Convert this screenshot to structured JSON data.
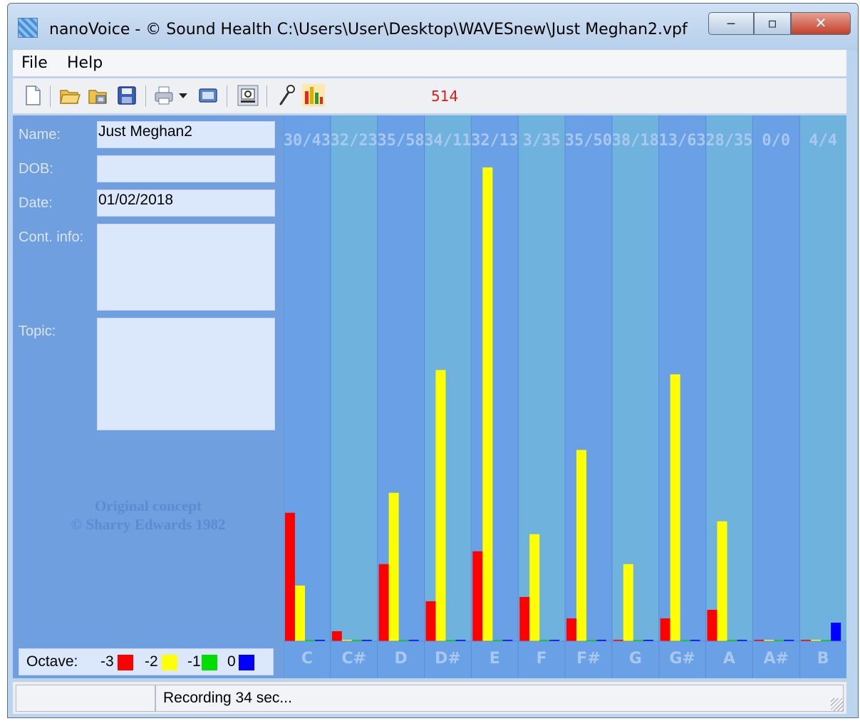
{
  "window": {
    "title": "nanoVoice - © Sound Health C:\\Users\\User\\Desktop\\WAVESnew\\Just Meghan2.vpf"
  },
  "menu": {
    "file": "File",
    "help": "Help"
  },
  "toolbar": {
    "icons": [
      "new-icon",
      "open-icon",
      "open-archive-icon",
      "save-icon",
      "print-icon",
      "dropdown-icon",
      "screen-icon",
      "chart-mode-icon",
      "microphone-icon",
      "bar-chart-icon"
    ],
    "counter": "514"
  },
  "form": {
    "name_label": "Name:",
    "name_value": "Just Meghan2",
    "dob_label": "DOB:",
    "dob_value": "",
    "date_label": "Date:",
    "date_value": "01/02/2018",
    "contact_label": "Cont. info:",
    "contact_value": "",
    "topic_label": "Topic:",
    "topic_value": "",
    "concept_line1": "Original concept",
    "concept_line2": "© Sharry Edwards 1982"
  },
  "octave_legend": {
    "label": "Octave:",
    "items": [
      {
        "label": "-3",
        "color": "#ff0000"
      },
      {
        "label": "-2",
        "color": "#ffff00"
      },
      {
        "label": "-1",
        "color": "#00dd00"
      },
      {
        "label": "0",
        "color": "#0000ff"
      }
    ]
  },
  "chart_data": {
    "type": "bar",
    "categories": [
      "C",
      "C#",
      "D",
      "D#",
      "E",
      "F",
      "F#",
      "G",
      "G#",
      "A",
      "A#",
      "B"
    ],
    "top_labels": [
      "30/43",
      "32/23",
      "35/58",
      "34/11",
      "32/13",
      "3/35",
      "35/50",
      "38/18",
      "13/63",
      "28/35",
      "0/0",
      "4/4"
    ],
    "ylim": [
      0,
      665
    ],
    "series": [
      {
        "name": "-3",
        "color": "#ff0000",
        "values": [
          180,
          14,
          108,
          56,
          126,
          62,
          32,
          0,
          32,
          44,
          0,
          0
        ]
      },
      {
        "name": "-2",
        "color": "#ffff00",
        "values": [
          78,
          0,
          208,
          380,
          664,
          150,
          268,
          108,
          374,
          168,
          0,
          0
        ]
      },
      {
        "name": "-1",
        "color": "#00dd00",
        "values": [
          0,
          0,
          0,
          0,
          0,
          0,
          0,
          0,
          0,
          0,
          0,
          0
        ]
      },
      {
        "name": "0",
        "color": "#0000ff",
        "values": [
          0,
          0,
          0,
          0,
          0,
          0,
          0,
          0,
          0,
          0,
          0,
          26
        ]
      }
    ],
    "grid": true,
    "background": "#6aa0e6",
    "column_alt_color": "#6fb2dd"
  },
  "status": {
    "text": "Recording 34 sec..."
  }
}
